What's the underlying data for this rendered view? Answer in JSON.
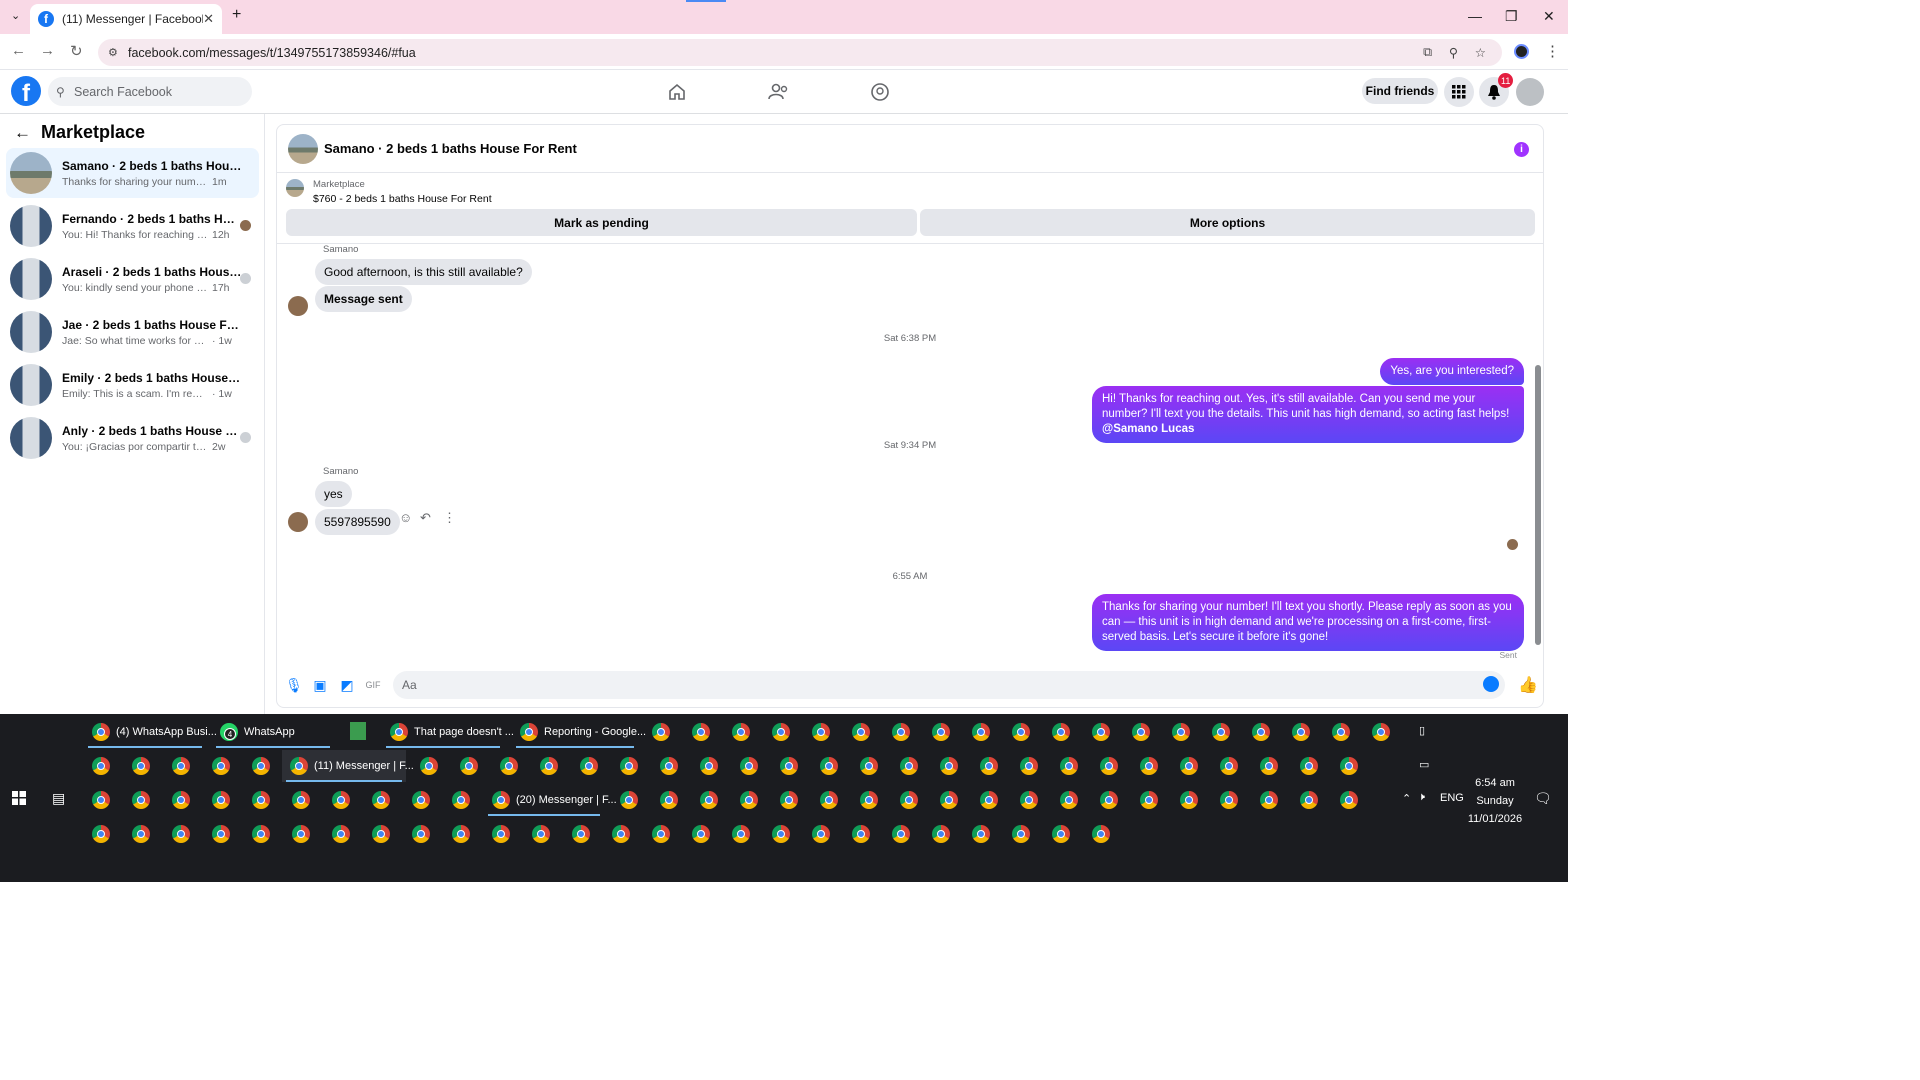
{
  "browser": {
    "tab_title": "(11) Messenger | Facebook",
    "url": "facebook.com/messages/t/1349755173859346/#fua"
  },
  "facebook": {
    "search_placeholder": "Search Facebook",
    "find_friends": "Find friends",
    "notification_count": "11"
  },
  "sidebar": {
    "title": "Marketplace",
    "conversations": [
      {
        "name": "Samano · 2 beds 1 baths House Fo...",
        "preview": "Thanks for sharing your number! I'll t...",
        "time": "1m",
        "active": true
      },
      {
        "name": "Fernando · 2 beds 1 baths Hous...",
        "preview": "You: Hi! Thanks for reaching out. Y...",
        "time": "12h"
      },
      {
        "name": "Araseli · 2 beds 1 baths House F...",
        "preview": "You: kindly send your phone num...",
        "time": "17h"
      },
      {
        "name": "Jae · 2 beds 1 baths House For Rent",
        "preview": "Jae: So what time works for you tomo...",
        "time": "· 1w"
      },
      {
        "name": "Emily · 2 beds 1 baths House For R...",
        "preview": "Emily: This is a scam. I'm reporting",
        "time": "· 1w"
      },
      {
        "name": "Anly · 2 beds 1 baths House For ...",
        "preview": "You: ¡Gracias por compartir tu núm...",
        "time": "2w"
      }
    ]
  },
  "chat": {
    "title": "Samano · 2 beds 1 baths House For Rent",
    "marketplace_label": "Marketplace",
    "listing": "$760 - 2 beds 1 baths House For Rent",
    "mark_pending": "Mark as pending",
    "more_options": "More options",
    "sender1": "Samano",
    "msg1": "Good afternoon, is this still available?",
    "msg2": "Message sent",
    "ts1": "Sat 6:38 PM",
    "out1": "Yes, are you interested?",
    "out2": "Hi! Thanks for reaching out. Yes, it's still available. Can you send me your number? I'll text you the details. This unit has high demand, so acting fast helps!",
    "out2_mention": "@Samano Lucas",
    "ts2": "Sat 9:34 PM",
    "sender2": "Samano",
    "msg3": "yes",
    "msg4": "5597895590",
    "ts3": "6:55 AM",
    "out3": "Thanks for sharing your number! I'll text you shortly. Please reply as soon as you can — this unit is in high demand and we're processing on a first-come, first-served basis. Let's secure it before it's gone!",
    "status": "Sent",
    "composer_placeholder": "Aa"
  },
  "taskbar": {
    "items": [
      "(4) WhatsApp Busi...",
      "WhatsApp",
      "That page doesn't ...",
      "Reporting - Google...",
      "(11) Messenger | F...",
      "(20) Messenger | F..."
    ],
    "whatsapp_badge": "4",
    "lang": "ENG",
    "time": "6:54 am",
    "day": "Sunday",
    "date": "11/01/2026"
  }
}
